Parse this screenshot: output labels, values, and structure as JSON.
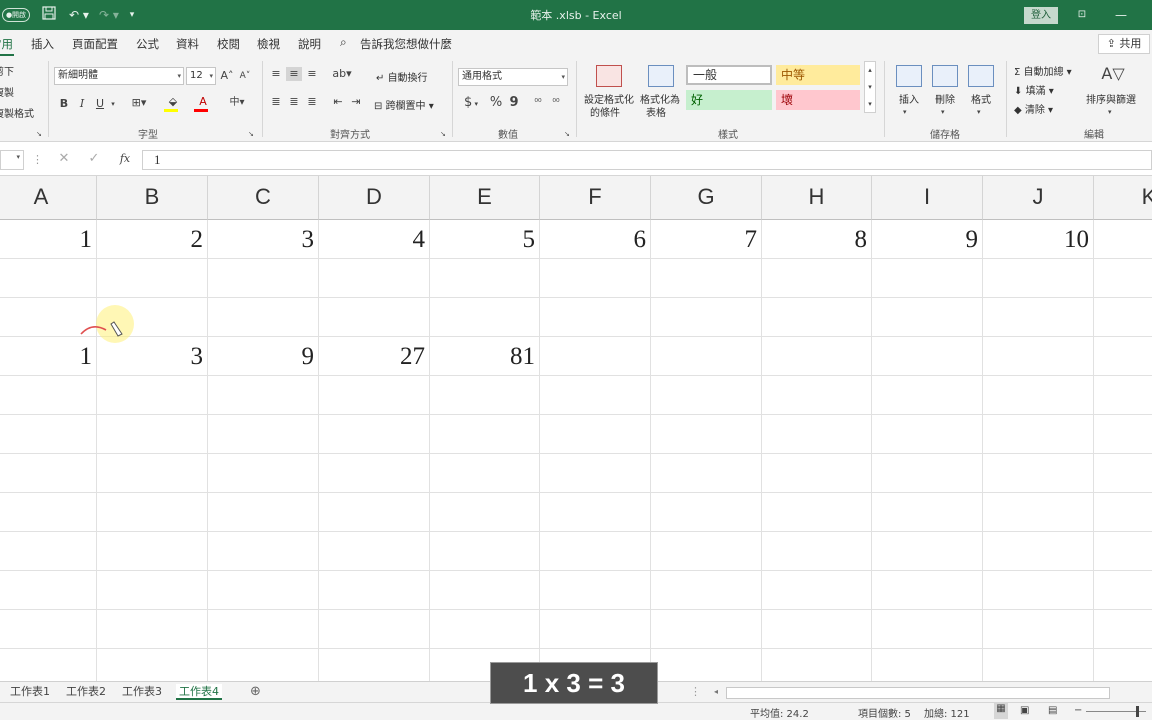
{
  "titlebar": {
    "autosave_label": "●開啟",
    "title": "範本 .xlsb - Excel",
    "login_label": "登入"
  },
  "tabs": [
    {
      "label": "常用",
      "active": true
    },
    {
      "label": "插入"
    },
    {
      "label": "頁面配置"
    },
    {
      "label": "公式"
    },
    {
      "label": "資料"
    },
    {
      "label": "校閱"
    },
    {
      "label": "檢視"
    },
    {
      "label": "說明"
    }
  ],
  "search_hint": "告訴我您想做什麼",
  "share_label": "共用",
  "clipboard": {
    "cut": "剪下",
    "copy": "複製",
    "format_painter": "複製格式"
  },
  "font": {
    "name": "新細明體",
    "size": "12",
    "bold": "B",
    "italic": "I",
    "underline": "U",
    "group_label": "字型"
  },
  "alignment": {
    "wrap_text": "自動換行",
    "merge_center": "跨欄置中",
    "group_label": "對齊方式"
  },
  "number": {
    "format": "通用格式",
    "currency": "$",
    "percent": "%",
    "comma": "9",
    "group_label": "數值"
  },
  "styles": {
    "conditional_formatting_line1": "設定格式化",
    "conditional_formatting_line2": "的條件",
    "format_as_table_line1": "格式化為",
    "format_as_table_line2": "表格",
    "normal": "一般",
    "neutral": "中等",
    "good": "好",
    "bad": "壞",
    "group_label": "樣式",
    "colors": {
      "neutral": "#ffeb9c",
      "good": "#c6efce",
      "bad": "#ffc7ce",
      "good_text": "#006100",
      "bad_text": "#9c0006",
      "neutral_text": "#9c5700"
    }
  },
  "cells_group": {
    "insert": "插入",
    "delete": "刪除",
    "format": "格式",
    "group_label": "儲存格"
  },
  "editing": {
    "autosum": "自動加總",
    "fill": "填滿",
    "clear": "清除",
    "sort_filter": "排序與篩選",
    "group_label": "編輯"
  },
  "formula_bar": {
    "fx": "fx",
    "value": "1"
  },
  "columns": [
    "A",
    "B",
    "C",
    "D",
    "E",
    "F",
    "G",
    "H",
    "I",
    "J",
    "K"
  ],
  "rows": [
    [
      "1",
      "2",
      "3",
      "4",
      "5",
      "6",
      "7",
      "8",
      "9",
      "10",
      ""
    ],
    [
      "",
      "",
      "",
      "",
      "",
      "",
      "",
      "",
      "",
      "",
      ""
    ],
    [
      "",
      "",
      "",
      "",
      "",
      "",
      "",
      "",
      "",
      "",
      ""
    ],
    [
      "1",
      "3",
      "9",
      "27",
      "81",
      "",
      "",
      "",
      "",
      "",
      ""
    ],
    [
      "",
      "",
      "",
      "",
      "",
      "",
      "",
      "",
      "",
      "",
      ""
    ],
    [
      "",
      "",
      "",
      "",
      "",
      "",
      "",
      "",
      "",
      "",
      ""
    ],
    [
      "",
      "",
      "",
      "",
      "",
      "",
      "",
      "",
      "",
      "",
      ""
    ],
    [
      "",
      "",
      "",
      "",
      "",
      "",
      "",
      "",
      "",
      "",
      ""
    ],
    [
      "",
      "",
      "",
      "",
      "",
      "",
      "",
      "",
      "",
      "",
      ""
    ],
    [
      "",
      "",
      "",
      "",
      "",
      "",
      "",
      "",
      "",
      "",
      ""
    ],
    [
      "",
      "",
      "",
      "",
      "",
      "",
      "",
      "",
      "",
      "",
      ""
    ],
    [
      "",
      "",
      "",
      "",
      "",
      "",
      "",
      "",
      "",
      "",
      ""
    ],
    [
      "",
      "",
      "",
      "",
      "",
      "",
      "",
      "",
      "",
      "",
      ""
    ]
  ],
  "sheets": [
    {
      "label": "工作表1"
    },
    {
      "label": "工作表2"
    },
    {
      "label": "工作表3"
    },
    {
      "label": "工作表4",
      "active": true
    }
  ],
  "status": {
    "average": "平均值: 24.2",
    "count": "項目個數: 5",
    "sum": "加總: 121"
  },
  "caption": "1 x 3 = 3",
  "colors": {
    "excel_green": "#217346"
  }
}
